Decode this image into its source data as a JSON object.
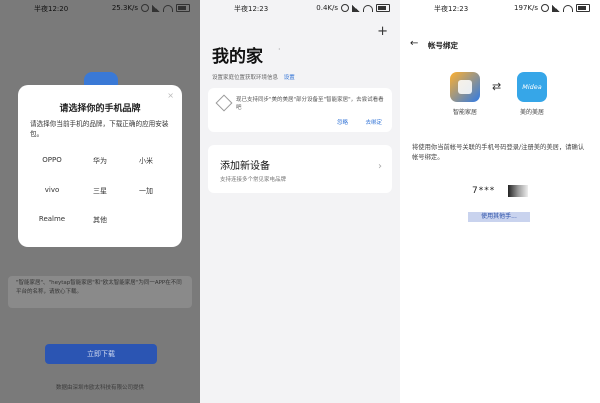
{
  "status_bars": [
    {
      "time": "半夜12:20",
      "speed": "25.3K/s"
    },
    {
      "time": "半夜12:23",
      "speed": "0.4K/s"
    },
    {
      "time": "半夜12:23",
      "speed": "197K/s"
    }
  ],
  "panel1": {
    "dialog": {
      "title": "请选择你的手机品牌",
      "description": "请选择你当前手机的品牌，下载正确的应用安装包。",
      "close": "×",
      "brands": [
        "OPPO",
        "华为",
        "小米",
        "vivo",
        "三星",
        "一加",
        "Realme",
        "其他"
      ]
    },
    "note": "\"智能家居\"、\"heytap智能家居\"和\"欧太智能家居\"为同一APP在不同平台的名称，请放心下载。",
    "download_button": "立即下载",
    "footer": "数据由深圳市欧太科技有限公司提供"
  },
  "panel2": {
    "add_icon": "+",
    "title": "我的家",
    "title_mark": "·",
    "subtitle": "设置家庭位置获取环境信息",
    "subtitle_link": "设置",
    "notice": {
      "text": "现已支持同步\"美的美居\"部分设备至\"智能家居\"，去尝试看看吧",
      "ignore": "忽略",
      "bind": "去绑定"
    },
    "add_device": {
      "title": "添加新设备",
      "subtitle": "支持连接多个常见家电品牌",
      "chevron": "›"
    }
  },
  "panel3": {
    "back_icon": "←",
    "title": "帐号绑定",
    "app_left_label": "智能家居",
    "swap_icon": "⇄",
    "app_right_logo": "Midea",
    "app_right_label": "美的美居",
    "description": "将使用你当前帐号关联的手机号码登录/注册美的美居，请确认帐号绑定。",
    "phone_masked": "7***",
    "other_button": "使用其他手..."
  },
  "colors": {
    "accent": "#2f72d6",
    "download_button": "#2b55b3",
    "overlay": "#7a7a7a"
  }
}
